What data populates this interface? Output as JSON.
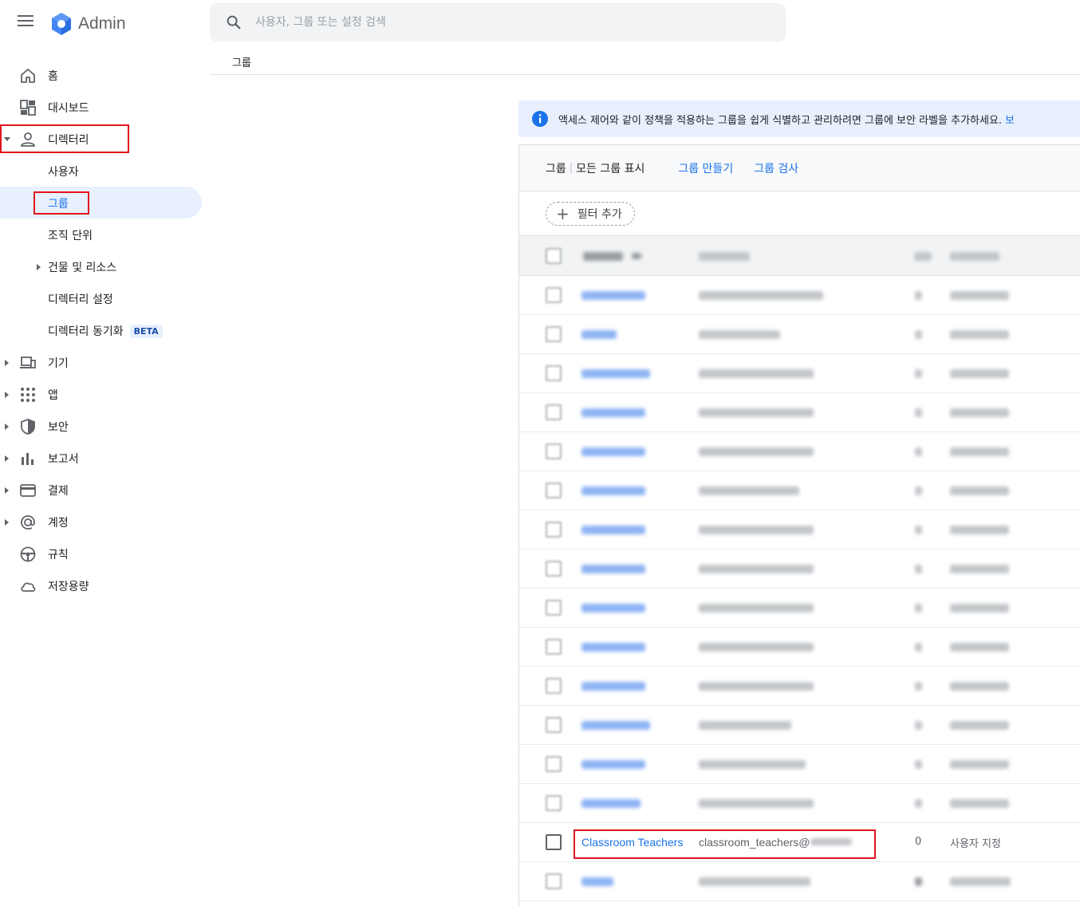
{
  "app": {
    "title": "Admin"
  },
  "search": {
    "placeholder": "사용자, 그룹 또는 설정 검색"
  },
  "breadcrumb": {
    "current": "그룹"
  },
  "sidebar": {
    "items": [
      {
        "label": "홈",
        "icon": "home-icon"
      },
      {
        "label": "대시보드",
        "icon": "dashboard-icon"
      },
      {
        "label": "디렉터리",
        "icon": "person-icon",
        "expanded": true
      },
      {
        "label": "사용자"
      },
      {
        "label": "그룹",
        "active": true
      },
      {
        "label": "조직 단위"
      },
      {
        "label": "건물 및 리소스"
      },
      {
        "label": "디렉터리 설정"
      },
      {
        "label": "디렉터리 동기화",
        "badge": "BETA"
      },
      {
        "label": "기기",
        "icon": "devices-icon"
      },
      {
        "label": "앱",
        "icon": "apps-grid-icon"
      },
      {
        "label": "보안",
        "icon": "shield-icon"
      },
      {
        "label": "보고서",
        "icon": "bar-chart-icon"
      },
      {
        "label": "결제",
        "icon": "credit-card-icon"
      },
      {
        "label": "계정",
        "icon": "at-sign-icon"
      },
      {
        "label": "규칙",
        "icon": "steering-wheel-icon"
      },
      {
        "label": "저장용량",
        "icon": "cloud-icon"
      }
    ]
  },
  "banner": {
    "text": "액세스 제어와 같이 정책을 적용하는 그룹을 쉽게 식별하고 관리하려면 그룹에 보안 라벨을 추가하세요.",
    "link": "보"
  },
  "card": {
    "title": "그룹",
    "subtitle": "모든 그룹 표시",
    "create_link": "그룹 만들기",
    "search_link": "그룹 검사",
    "filter_label": "필터 추가"
  },
  "highlight_row": {
    "name": "Classroom Teachers",
    "email": "classroom_teachers@",
    "members": "0",
    "created_by": "사용자 지정"
  },
  "colors": {
    "accent": "#1a73e8",
    "highlight_box": "#e0141e",
    "active_nav_bg": "#e8f0fe"
  }
}
